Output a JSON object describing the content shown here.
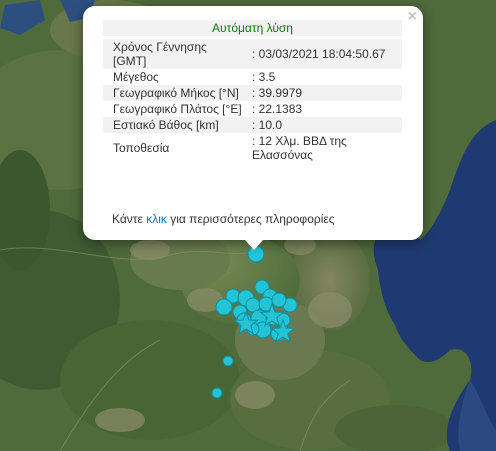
{
  "popup": {
    "title": "Αυτόματη λύση",
    "close": "×",
    "rows": [
      {
        "label": "Χρόνος Γέννησης [GMT]",
        "value": ": 03/03/2021 18:04:50.67"
      },
      {
        "label": "Μέγεθος",
        "value": ": 3.5"
      },
      {
        "label": "Γεωγραφικό Μήκος [°N]",
        "value": ": 39.9979"
      },
      {
        "label": "Γεωγραφικό Πλάτος [°E]",
        "value": ": 22.1383"
      },
      {
        "label": "Εστιακό Βάθος [km]",
        "value": ": 10.0"
      },
      {
        "label": "Τοποθεσία",
        "value": ": 12 Χλμ. ΒΒΔ της Ελασσόνας"
      }
    ],
    "more_prefix": "Κάντε ",
    "more_link": "κλικ",
    "more_suffix": " για περισσότερες πληροφορίες"
  },
  "colors": {
    "marker_fill": "#22c4d6",
    "marker_stroke": "#0e8fa0",
    "land": "#4d6b3a",
    "sea": "#1f3a72",
    "lake": "#2c4f80"
  },
  "markers": {
    "icons": [
      "circle-event-marker",
      "star-event-marker"
    ]
  }
}
